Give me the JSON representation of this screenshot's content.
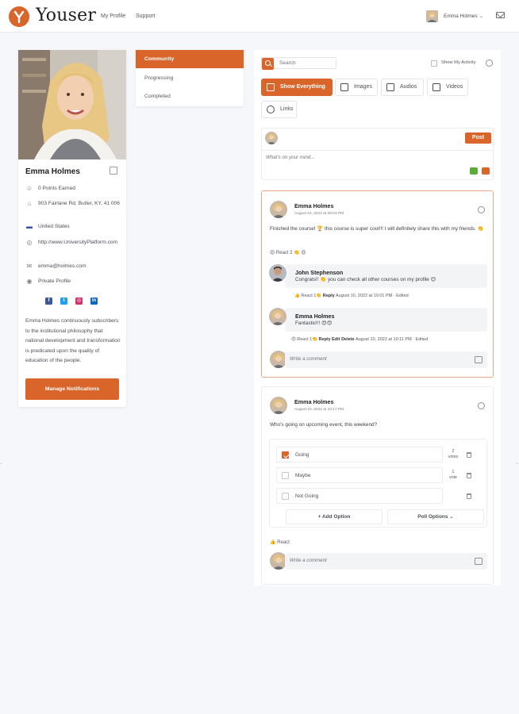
{
  "brand": {
    "name": "Youser",
    "accent": "#d9652a"
  },
  "nav": {
    "links": [
      "My Profile",
      "Support"
    ]
  },
  "user_menu": {
    "name": "Emma Holmes"
  },
  "profile": {
    "name": "Emma Holmes",
    "rows": [
      {
        "icon": "person-icon",
        "text": "0 Points Earned"
      },
      {
        "icon": "location-icon",
        "text": "903 Fairlane Rd, Butler, KY, 41 006"
      },
      {
        "icon": "flag-us-icon",
        "text": "United States"
      },
      {
        "icon": "globe-icon",
        "text": "http://www.UniversityPlatform.com"
      },
      {
        "icon": "email-icon",
        "text": "emma@holmes.com"
      },
      {
        "icon": "eye-icon",
        "text": "Private Profile"
      }
    ],
    "socials": [
      "facebook-icon",
      "twitter-icon",
      "instagram-icon",
      "linkedin-icon"
    ],
    "bio": "Emma Holmes continuously subscribers to the institutional philosophy that national development and transformation is predicated upon the quality of education of the people.",
    "manage_label": "Manage Notifications"
  },
  "tabs": [
    {
      "label": "Community",
      "active": true
    },
    {
      "label": "Progressing",
      "active": false
    },
    {
      "label": "Completed",
      "active": false
    }
  ],
  "feed": {
    "search_placeholder": "Search",
    "show_activity_label": "Show My Activity",
    "filters": [
      "Show Everything",
      "Images",
      "Audios",
      "Videos",
      "Links"
    ],
    "composer": {
      "placeholder": "What's on your mind...",
      "post_label": "Post"
    },
    "post1": {
      "author": "Emma Holmes",
      "date": "August 10, 2022 at 09:03 PM",
      "text": "Finished the course! 🏆 this course is super cool!!! I will definitely share this with my friends. 👏",
      "reactions": "😍 React 2 👏 😍",
      "reply1": {
        "author": "John Stephenson",
        "text": "Congrats!! 👏 you can check all other courses on my profile 😊",
        "react": "React",
        "count": "1",
        "reply": "Reply",
        "date": "August 10, 2022 at 10:01 PM",
        "edited": "Edited"
      },
      "reply2": {
        "author": "Emma Holmes",
        "text": "Fantastic!!! 😍😍",
        "react": "React",
        "count": "1",
        "reply": "Reply",
        "edit": "Edit",
        "delete": "Delete",
        "date": "August 10, 2022 at 10:11 PM",
        "edited": "Edited"
      },
      "comment_placeholder": "Write a comment"
    },
    "post2": {
      "author": "Emma Holmes",
      "date": "August 10, 2022 at 10:17 PM",
      "text": "Who's going on upcoming event, this weekend?",
      "poll": [
        {
          "label": "Going",
          "checked": true,
          "votes_num": "2",
          "votes_word": "votes"
        },
        {
          "label": "Maybe",
          "checked": false,
          "votes_num": "1",
          "votes_word": "vote"
        },
        {
          "label": "Not Going",
          "checked": false,
          "votes_num": "",
          "votes_word": ""
        }
      ],
      "add_option": "Add Option",
      "poll_options": "Poll Options",
      "react": "React",
      "comment_placeholder": "Write a comment"
    }
  }
}
